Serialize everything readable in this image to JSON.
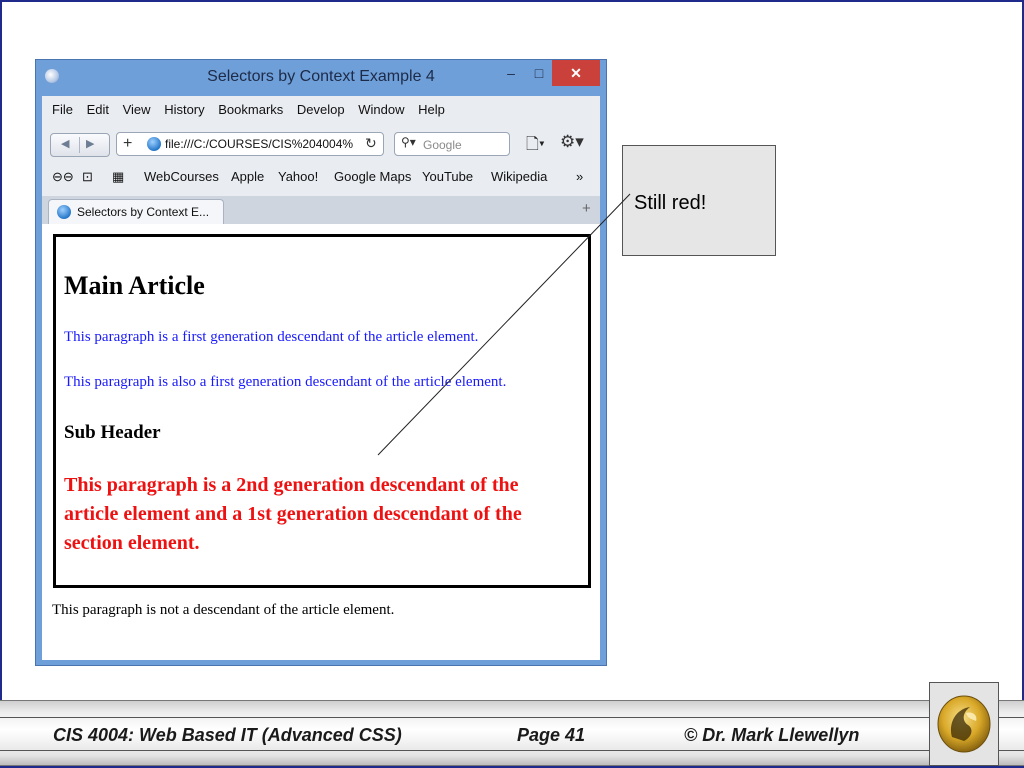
{
  "browser": {
    "title": "Selectors by Context Example 4",
    "controls": {
      "minimize": "–",
      "maximize": "□",
      "close": "✕"
    },
    "menu": [
      "File",
      "Edit",
      "View",
      "History",
      "Bookmarks",
      "Develop",
      "Window",
      "Help"
    ],
    "nav": {
      "back": "◀",
      "forward": "▶",
      "add": "+",
      "reload": "↻"
    },
    "url": "file:///C:/COURSES/CIS%204004%",
    "search_placeholder": "Google",
    "bookmarks": [
      "WebCourses",
      "Apple",
      "Yahoo!",
      "Google Maps",
      "YouTube",
      "Wikipedia"
    ],
    "bookmark_icons": {
      "reader": "⊖⊖",
      "book": "⊡",
      "grid": "▦",
      "more": "»"
    },
    "tab": {
      "label": "Selectors by Context E...",
      "new_tab": "+"
    }
  },
  "page": {
    "heading": "Main Article",
    "para1": "This paragraph is a first generation descendant of the article element.",
    "para2": "This paragraph is also a first generation descendant of the article element.",
    "subheader": "Sub Header",
    "para3": "This paragraph is a 2nd generation descendant of the article element and a 1st generation descendant of the section element.",
    "outside": "This paragraph is not a descendant of the article element.",
    "colors": {
      "blue_text": "#1a1aff",
      "red_text": "#ee1111"
    }
  },
  "callout": {
    "text": "Still red!"
  },
  "footer": {
    "course": "CIS 4004: Web Based IT (Advanced CSS)",
    "page": "Page 41",
    "author": "© Dr. Mark Llewellyn"
  }
}
